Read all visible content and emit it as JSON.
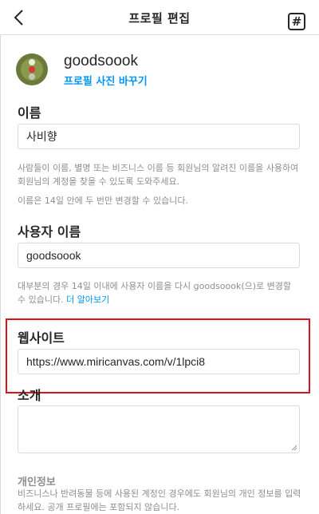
{
  "header": {
    "title": "프로필 편집",
    "hash_label": "#"
  },
  "profile": {
    "username": "goodsoook",
    "change_photo": "프로필 사진 바꾸기"
  },
  "name": {
    "label": "이름",
    "value": "사비향",
    "help1": "사람들이 이름, 별명 또는 비즈니스 이름 등 회원님의 알려진 이름을 사용하여 회원님의 계정을 찾을 수 있도록 도와주세요.",
    "help2": "이름은 14일 안에 두 번만 변경할 수 있습니다."
  },
  "username": {
    "label": "사용자 이름",
    "value": "goodsoook",
    "help": "대부분의 경우 14일 이내에 사용자 이름을 다시 goodsoook(으)로 변경할 수 있습니다. ",
    "learn_more": "더 알아보기"
  },
  "website": {
    "label": "웹사이트",
    "value": "https://www.miricanvas.com/v/1lpci8"
  },
  "bio": {
    "label": "소개",
    "value": ""
  },
  "personal": {
    "title": "개인정보",
    "help": "비즈니스나 반려동물 등에 사용된 계정인 경우에도 회원님의 개인 정보를 입력하세요. 공개 프로필에는 포함되지 않습니다."
  },
  "colors": {
    "accent": "#0095f6",
    "highlight": "#d8141c",
    "border": "#dbdbdb",
    "muted": "#8e8e8e"
  }
}
